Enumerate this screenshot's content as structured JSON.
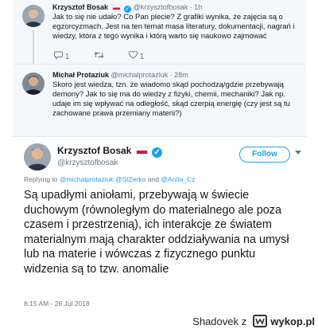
{
  "tweet1": {
    "name": "Krzysztof Bosak",
    "handle": "@krzysztofbosak",
    "time": "· 1h",
    "text": "Jak to się nie udało? Co Pan plecie? Z grafiki wynika, że zajęcia są o egzorcyzmach. Jest na ten temat masa literatury, dokumentacji, nagrań i wiedzy, która z tego wynika i którą warto się naukowo zajmować",
    "reply_count": "1",
    "like_count": "1"
  },
  "tweet2": {
    "name": "Michał Protaziuk",
    "handle": "@michalprotaziuk",
    "time": "· 28m",
    "text": "Skoro jest wiedza, tzn. że wiadomo skąd pochodzą/gdzie przebywają demony? Jak to się ma do wiedzy z fizyki, chemii, mechaniki? Jak np. udaje im się wpływać na odległość, skąd czerpią energię (czy jest są tu zachowane prawa przemiany materii?)"
  },
  "main_tweet": {
    "name": "Krzysztof Bosak",
    "handle": "@krzysztofbosak",
    "follow_label": "Follow",
    "replying_prefix": "Replying to",
    "mentions": [
      "@michalprotaziuk",
      "@StZerko",
      "@Anita_Cz"
    ],
    "and_word": "and",
    "text": "Są upadłymi aniołami, przebywają w świecie duchowym (równoległym do materialnego ale poza czasem i przestrzenią), ich interakcje ze światem materialnym mają charakter oddziaływania na umysł lub na materie i wówczas z fizycznego punktu widzenia są to tzw. anomalie",
    "timestamp": "8:15 AM - 26 Jul 2018"
  },
  "footer": {
    "author": "Shadovek",
    "z": "z",
    "site": "wykop.pl"
  },
  "colors": {
    "accent": "#1da1f2",
    "muted": "#657786",
    "text": "#14171a",
    "thread_bg": "#f5f8fa"
  }
}
